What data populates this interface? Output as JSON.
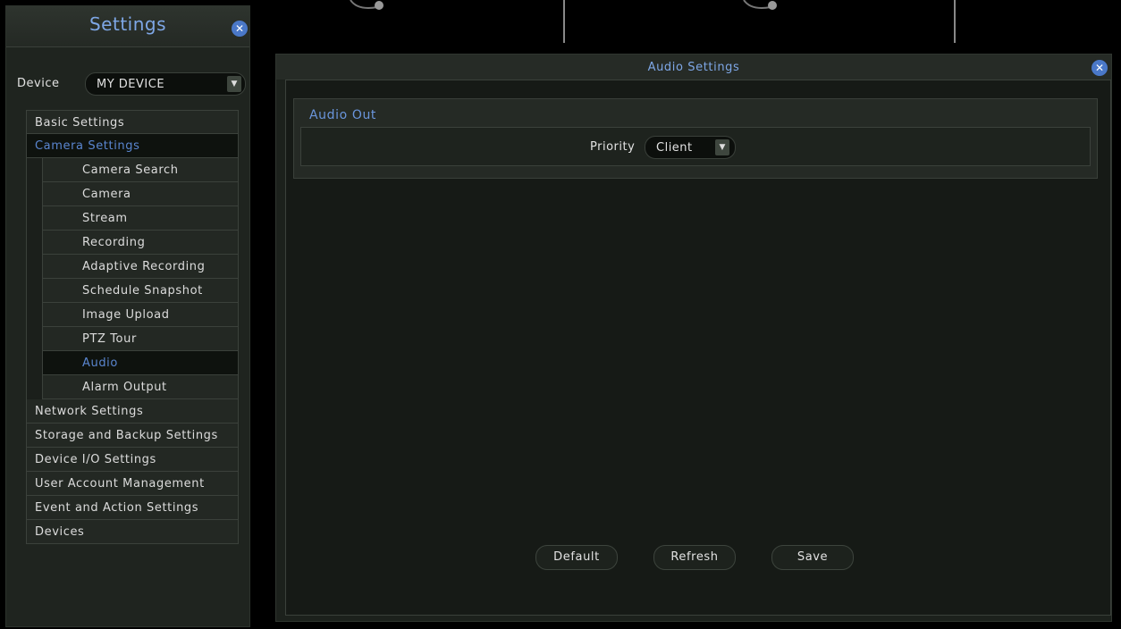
{
  "settings": {
    "title": "Settings",
    "device_label": "Device",
    "device_value": "MY DEVICE"
  },
  "menu": {
    "basic_settings": "Basic Settings",
    "camera_settings": "Camera Settings",
    "camera_sub": [
      "Camera Search",
      "Camera",
      "Stream",
      "Recording",
      "Adaptive Recording",
      "Schedule Snapshot",
      "Image Upload",
      "PTZ Tour",
      "Audio",
      "Alarm Output"
    ],
    "others": [
      "Network Settings",
      "Storage and Backup Settings",
      "Device I/O Settings",
      "User Account Management",
      "Event and Action Settings",
      "Devices"
    ]
  },
  "audio": {
    "title": "Audio Settings",
    "group_title": "Audio Out",
    "priority_label": "Priority",
    "priority_value": "Client"
  },
  "buttons": {
    "default": "Default",
    "refresh": "Refresh",
    "save": "Save"
  },
  "colors": {
    "accent": "#7ea7e6",
    "active_text": "#5a86d0",
    "panel_bg": "#1f241f"
  },
  "icons": {
    "close": "close-icon",
    "dropdown": "chevron-down-icon"
  }
}
